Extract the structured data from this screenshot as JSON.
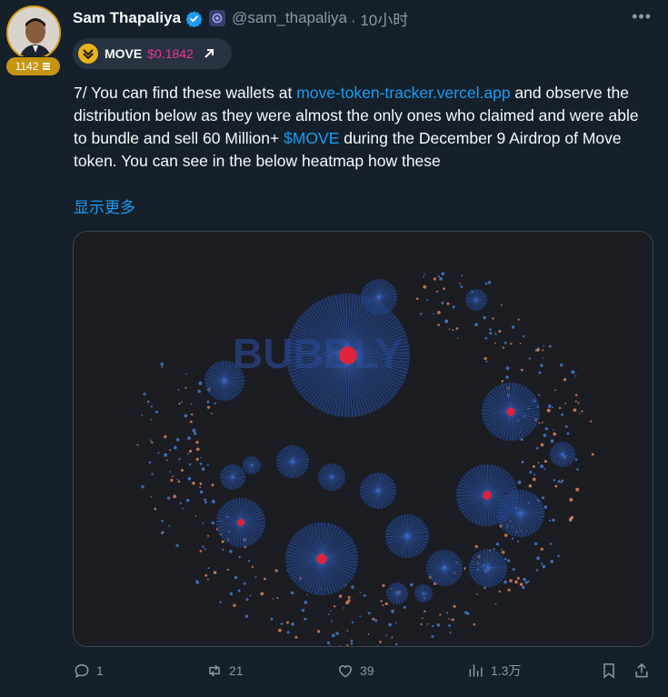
{
  "author": {
    "name": "Sam Thapaliya",
    "handle": "@sam_thapaliya",
    "time": "· 10小时",
    "badge_count": "1142"
  },
  "ticker": {
    "symbol": "MOVE",
    "price": "$0.1842"
  },
  "tweet": {
    "text_1": "7/ You can find these wallets at ",
    "link": "move-token-tracker.vercel.app",
    "text_2": " and observe the distribution below as they were almost the only ones who claimed and were able to bundle and sell 60 Million+ ",
    "cashtag": "$MOVE",
    "text_3": " during the December 9 Airdrop of Move token. You can see in the below heatmap how these",
    "show_more": "显示更多"
  },
  "media": {
    "watermark": "BUBBLY"
  },
  "actions": {
    "replies": "1",
    "reposts": "21",
    "likes": "39",
    "views": "1.3万"
  },
  "colors": {
    "background": "#15202b",
    "accent": "#1d9bf0",
    "price": "#f0309a",
    "badge": "#c79512"
  }
}
